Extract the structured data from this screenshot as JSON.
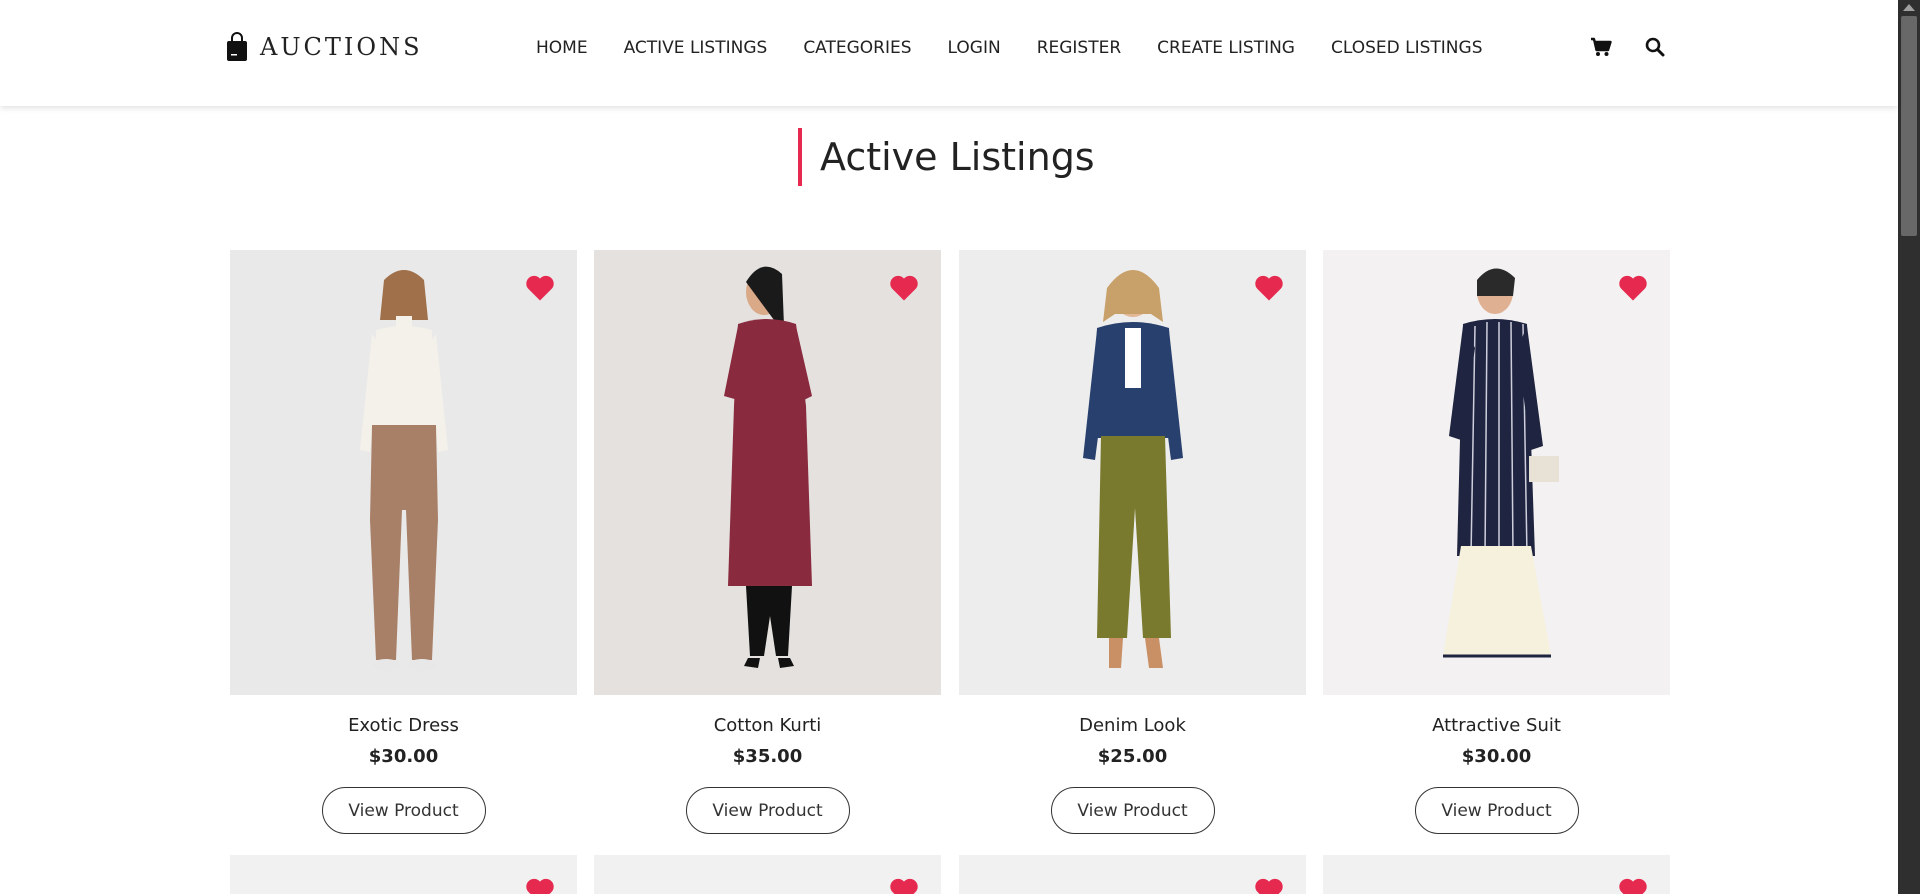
{
  "header": {
    "logo_text": "AUCTIONS",
    "nav": [
      "HOME",
      "ACTIVE LISTINGS",
      "CATEGORIES",
      "LOGIN",
      "REGISTER",
      "CREATE LISTING",
      "CLOSED LISTINGS"
    ]
  },
  "page": {
    "title": "Active Listings"
  },
  "products": [
    {
      "name": "Exotic Dress",
      "price": "$30.00",
      "button": "View Product"
    },
    {
      "name": "Cotton Kurti",
      "price": "$35.00",
      "button": "View Product"
    },
    {
      "name": "Denim Look",
      "price": "$25.00",
      "button": "View Product"
    },
    {
      "name": "Attractive Suit",
      "price": "$30.00",
      "button": "View Product"
    }
  ],
  "colors": {
    "accent": "#e6294f",
    "text": "#222222",
    "image_bg": "#ececec"
  },
  "icons": [
    "shopping-bag-icon",
    "cart-icon",
    "search-icon",
    "heart-icon"
  ]
}
